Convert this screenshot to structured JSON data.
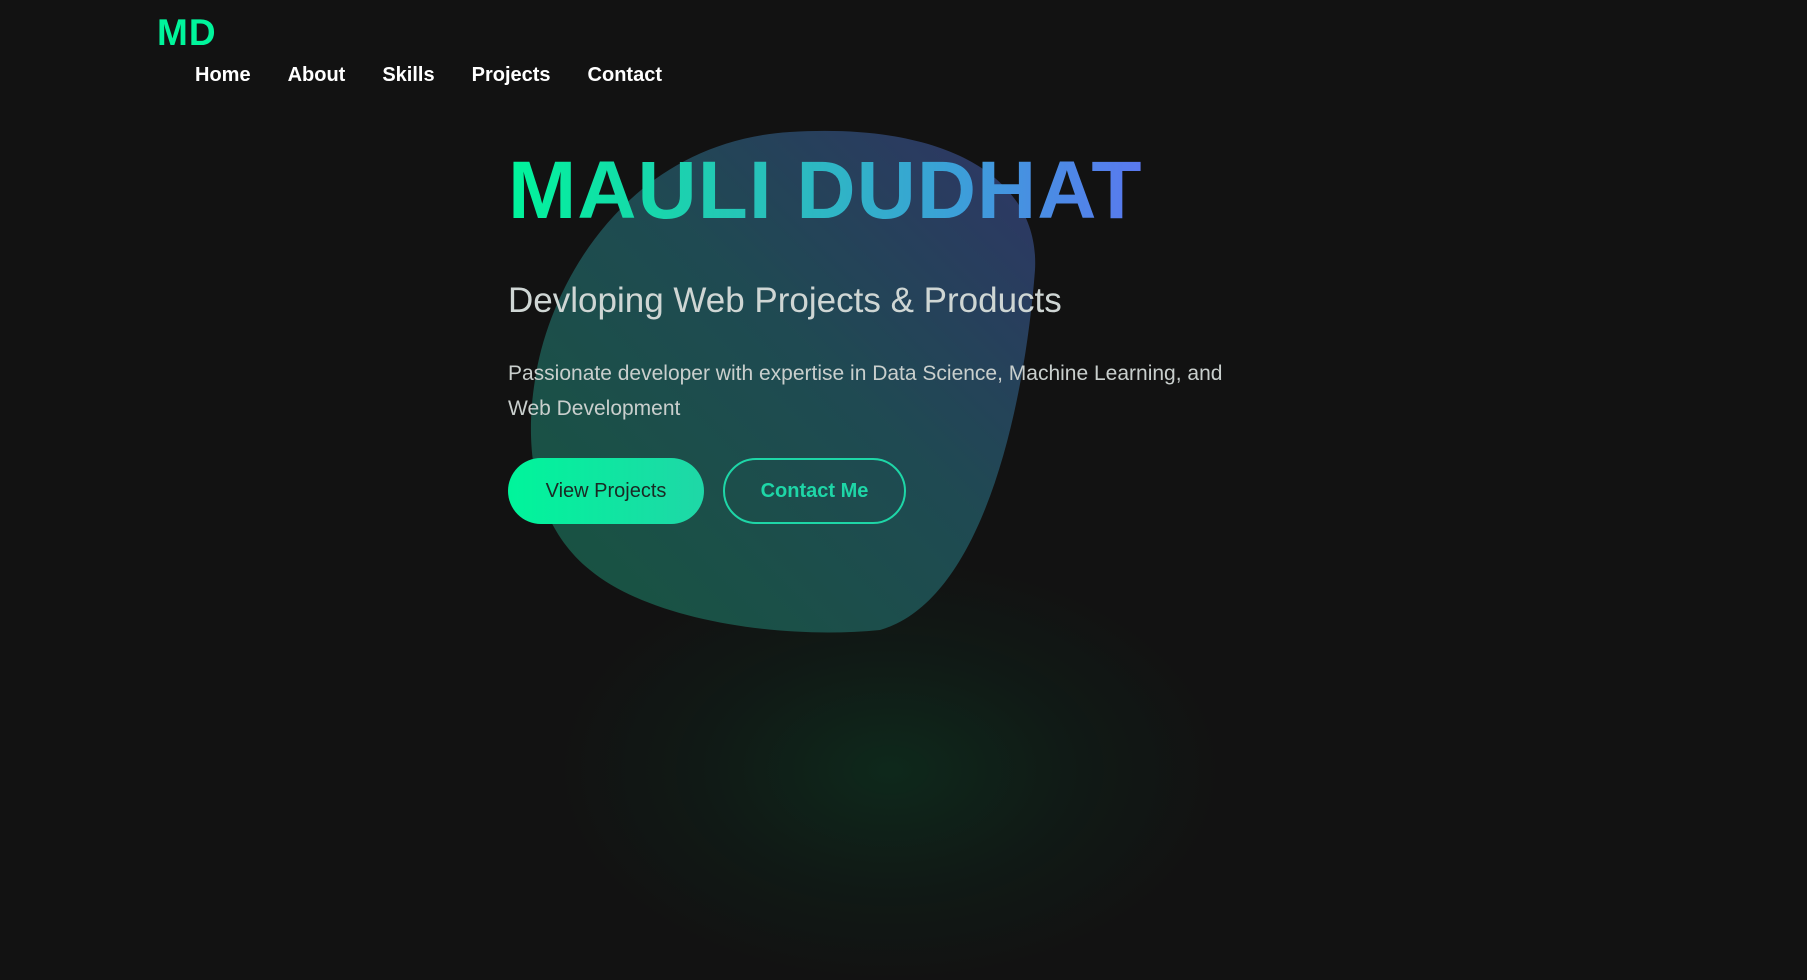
{
  "brand": {
    "logo": "MD"
  },
  "nav": {
    "items": [
      {
        "label": "Home"
      },
      {
        "label": "About"
      },
      {
        "label": "Skills"
      },
      {
        "label": "Projects"
      },
      {
        "label": "Contact"
      }
    ]
  },
  "hero": {
    "title": "MAULI DUDHAT",
    "subtitle": "Devloping Web Projects & Products",
    "description": "Passionate developer with expertise in Data Science, Machine Learning, and Web Development",
    "primary_button": "View Projects",
    "secondary_button": "Contact Me"
  },
  "colors": {
    "accent": "#00f59b",
    "background": "#121212",
    "gradient_end": "#5a78f0"
  }
}
